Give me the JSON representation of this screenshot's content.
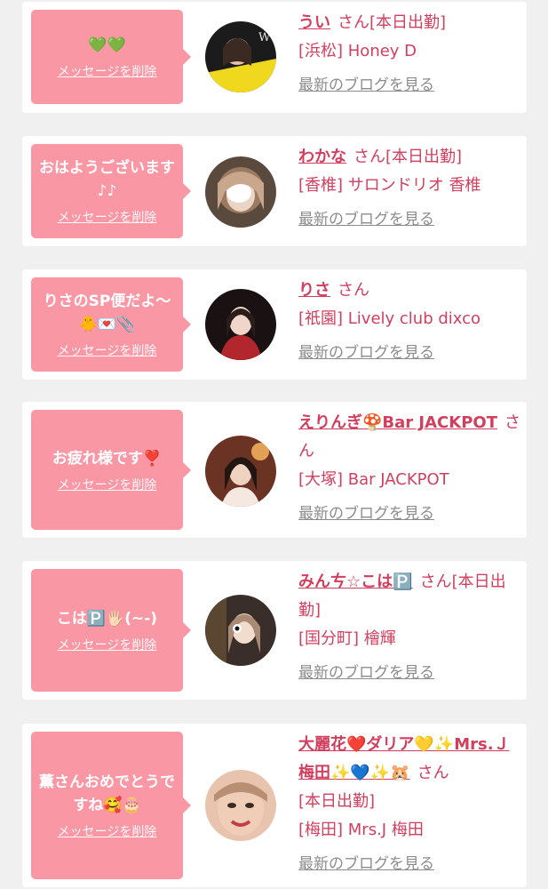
{
  "delete_label": "メッセージを削除",
  "blog_label": "最新のブログを見る",
  "san_label": "さん",
  "colors": {
    "page_bg": "#f0f0f0",
    "card_bg": "#ffffff",
    "bubble_pink": "#fa97a5",
    "name_red": "#d23f5e",
    "link_gray": "#8c8c8c"
  },
  "items": [
    {
      "message": "💚💚",
      "name": "うい",
      "status": "[本日出勤]",
      "shop": "[浜松] Honey D"
    },
    {
      "message": "おはようございます♪♪",
      "name": "わかな",
      "status": "[本日出勤]",
      "shop": "[香椎] サロンドリオ 香椎"
    },
    {
      "message": "りさのSP便だよ〜🐥💌📎",
      "name": "りさ",
      "status": "",
      "shop": "[祇園] Lively club dixco"
    },
    {
      "message": "お疲れ様です❣️",
      "name": "えりんぎ🍄Bar JACKPOT",
      "status": "",
      "shop": "[大塚] Bar JACKPOT"
    },
    {
      "message": "こは🅿️🖐🏻(~-)",
      "name": "みんㄘ☆こは🅿️",
      "status": "[本日出勤]",
      "shop": "[国分町] 檜輝"
    },
    {
      "message": "薫さんおめでとうですね🥰🎂",
      "name": "大麗花❤️ダリア💛✨Mrs.Ｊ梅田✨💙✨🐹",
      "status": "[本日出勤]",
      "shop": "[梅田] Mrs.J 梅田"
    }
  ]
}
